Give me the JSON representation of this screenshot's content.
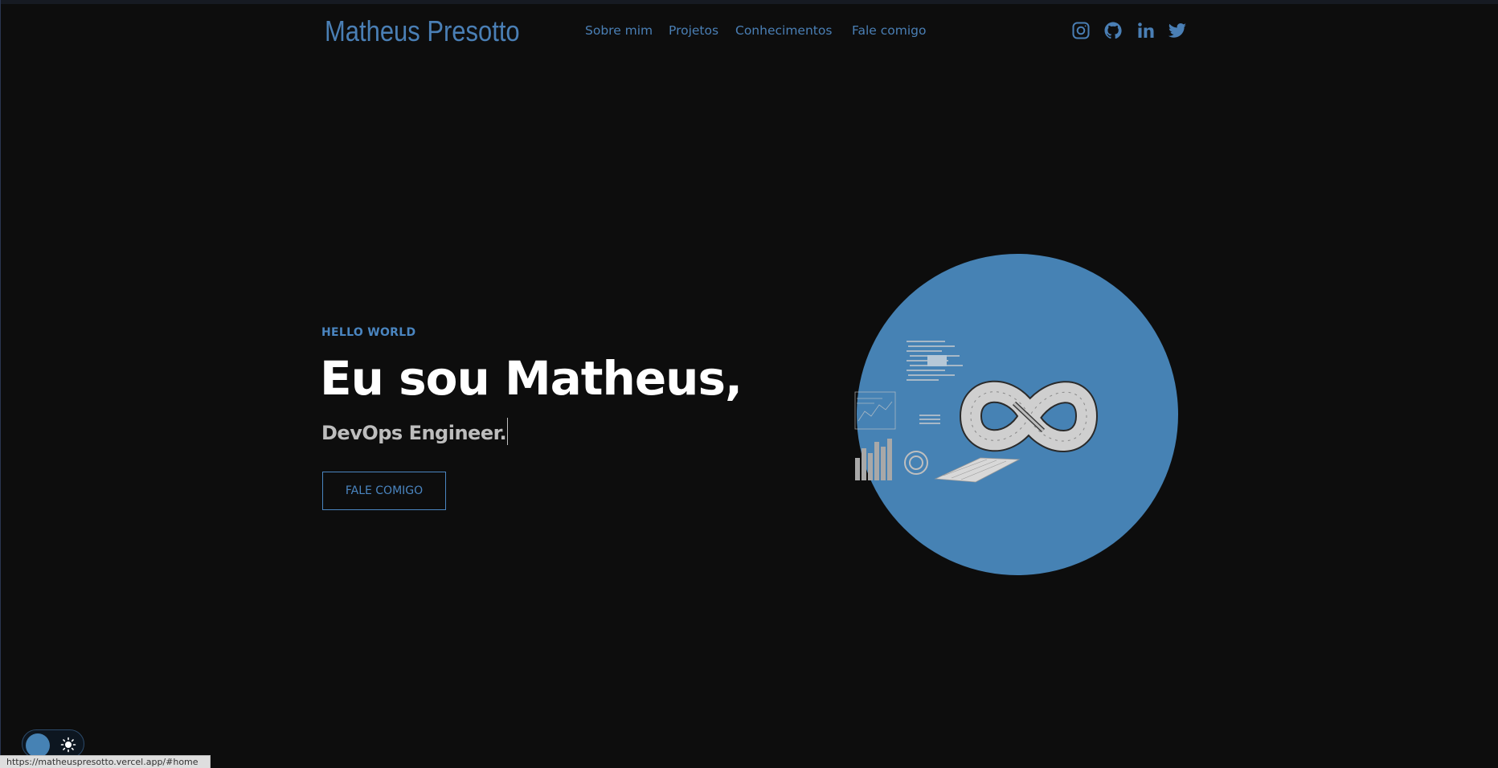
{
  "header": {
    "logo": "Matheus Presotto",
    "nav": [
      {
        "label": "Sobre mim"
      },
      {
        "label": "Projetos"
      },
      {
        "label": "Conhecimentos"
      },
      {
        "label": "Fale comigo"
      }
    ],
    "socials": [
      {
        "icon": "instagram-icon"
      },
      {
        "icon": "github-icon"
      },
      {
        "icon": "linkedin-icon"
      },
      {
        "icon": "twitter-icon"
      }
    ]
  },
  "hero": {
    "eyebrow": "HELLO WORLD",
    "headline": "Eu sou Matheus,",
    "role": "DevOps Engineer.",
    "cta_label": "FALE COMIGO",
    "illustration": "devops-infinity-illustration"
  },
  "theme_toggle": {
    "mode": "dark",
    "icon": "sun-icon"
  },
  "status_bar": {
    "url": "https://matheuspresotto.vercel.app/#home"
  },
  "colors": {
    "background": "#0d0d0d",
    "accent": "#4a7fb5",
    "circle": "#4682b4",
    "headline": "#ffffff",
    "subtitle": "#bdbdbd"
  }
}
